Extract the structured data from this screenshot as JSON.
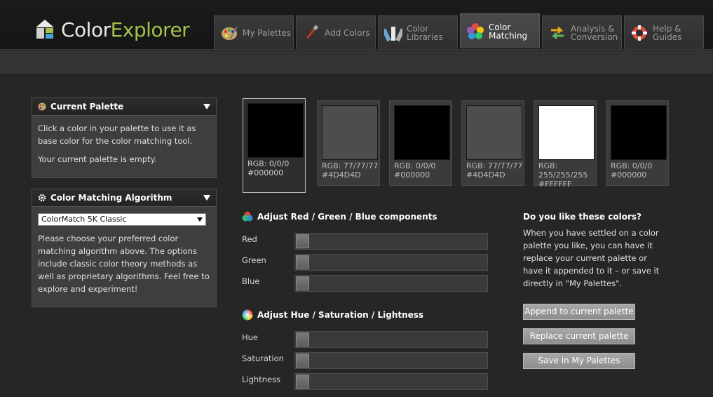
{
  "app": {
    "name_part1": "Color",
    "name_part2": "Explorer"
  },
  "tabs": [
    {
      "label": "My Palettes",
      "icon": "palette-icon",
      "active": false
    },
    {
      "label": "Add Colors",
      "icon": "paintbrush-icon",
      "active": false
    },
    {
      "label": "Color Libraries",
      "icon": "color-fan-icon",
      "active": false
    },
    {
      "label": "Color Matching",
      "icon": "color-wheel-icon",
      "active": true
    },
    {
      "label": "Analysis & Conversion",
      "icon": "convert-arrows-icon",
      "active": false
    },
    {
      "label": "Help & Guides",
      "icon": "lifebuoy-icon",
      "active": false
    }
  ],
  "current_palette": {
    "title": "Current Palette",
    "intro": "Click a color in your palette to use it as base color for the color matching tool.",
    "status": "Your current palette is empty."
  },
  "algorithm": {
    "title": "Color Matching Algorithm",
    "selected": "ColorMatch 5K Classic",
    "description": "Please choose your preferred color matching algorithm above. The options include classic color theory methods as well as proprietary algorithms. Feel free to explore and experiment!"
  },
  "swatches": [
    {
      "hex_color": "#000000",
      "rgb": "RGB: 0/0/0",
      "hex": "#000000",
      "selected": true
    },
    {
      "hex_color": "#4D4D4D",
      "rgb": "RGB: 77/77/77",
      "hex": "#4D4D4D",
      "selected": false
    },
    {
      "hex_color": "#000000",
      "rgb": "RGB: 0/0/0",
      "hex": "#000000",
      "selected": false
    },
    {
      "hex_color": "#4D4D4D",
      "rgb": "RGB: 77/77/77",
      "hex": "#4D4D4D",
      "selected": false
    },
    {
      "hex_color": "#FFFFFF",
      "rgb": "RGB: 255/255/255",
      "hex": "#FFFFFF",
      "selected": false
    },
    {
      "hex_color": "#000000",
      "rgb": "RGB: 0/0/0",
      "hex": "#000000",
      "selected": false
    }
  ],
  "rgb_section": {
    "title": "Adjust Red / Green / Blue components",
    "sliders": [
      {
        "label": "Red",
        "value": 0
      },
      {
        "label": "Green",
        "value": 0
      },
      {
        "label": "Blue",
        "value": 0
      }
    ]
  },
  "hsl_section": {
    "title": "Adjust Hue / Saturation / Lightness",
    "sliders": [
      {
        "label": "Hue",
        "value": 0
      },
      {
        "label": "Saturation",
        "value": 0
      },
      {
        "label": "Lightness",
        "value": 0
      }
    ]
  },
  "feedback": {
    "title": "Do you like these colors?",
    "text": "When you have settled on a color palette you like, you can have it replace your current palette or have it appended to it – or save it directly in \"My Palettes\".",
    "buttons": {
      "append": "Append to current palette",
      "replace": "Replace current palette",
      "save": "Save in My Palettes"
    }
  },
  "colors": {
    "accent": "#a2c24a",
    "button": "#9a9a9a",
    "background": "#262626"
  }
}
